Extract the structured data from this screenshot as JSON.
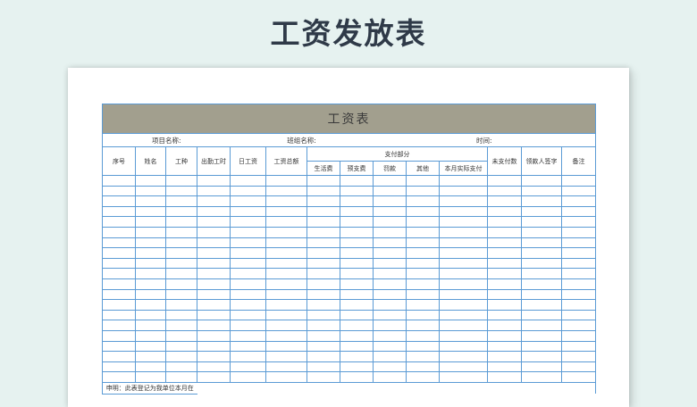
{
  "page_title": "工资发放表",
  "sheet": {
    "title": "工资表",
    "project_label": "项目名称:",
    "team_label": "班组名称:",
    "time_label": "时间:",
    "headers": {
      "seq": "序号",
      "name": "姓名",
      "job": "工种",
      "attendance": "出勤工时",
      "daily_wage": "日工资",
      "total_wage": "工资总额",
      "payment_group": "支付部分",
      "living": "生活费",
      "advance": "预支费",
      "fine": "罚款",
      "other": "其他",
      "actual_paid": "本月实际支付",
      "unpaid": "未支付数",
      "signature": "领款人签字",
      "remark": "备注"
    },
    "empty_row_count": 20,
    "note": "申明：此表登记为我单位本月在"
  },
  "colors": {
    "background": "#e6f2f0",
    "title_bar": "#a29f8e",
    "grid_line": "#5b9bd5",
    "heading_text": "#2f3a48"
  }
}
